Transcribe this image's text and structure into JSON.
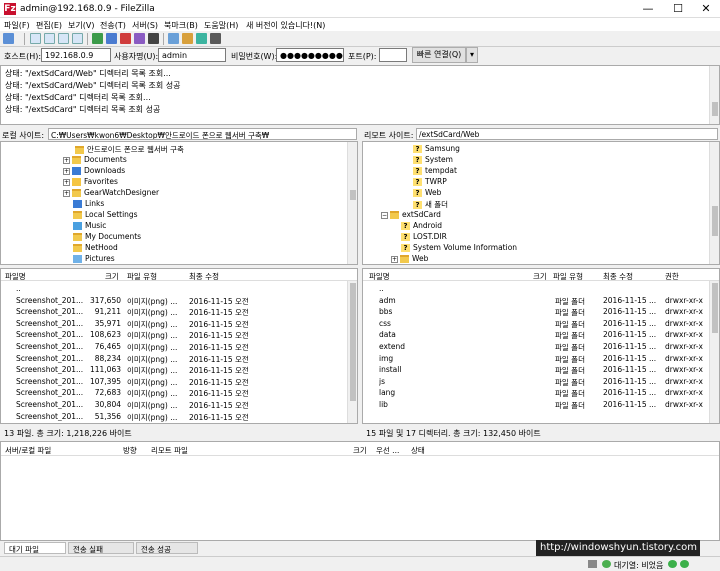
{
  "window": {
    "title": "admin@192.168.0.9 - FileZilla",
    "app_icon": "Fz"
  },
  "menu": [
    "파일(F)",
    "편집(E)",
    "보기(V)",
    "전송(T)",
    "서버(S)",
    "북마크(B)",
    "도움말(H)",
    "새 버전이 있습니다!(N)"
  ],
  "quickconnect": {
    "host_label": "호스트(H):",
    "host_value": "192.168.0.9",
    "user_label": "사용자명(U):",
    "user_value": "admin",
    "pass_label": "비밀번호(W):",
    "pass_value": "●●●●●●●●●",
    "port_label": "포트(P):",
    "port_value": "",
    "connect_label": "빠른 연결(Q)",
    "dropdown": "▾"
  },
  "log": [
    "상태:   \"/extSdCard/Web\" 디렉터리 목록 조회...",
    "상태:   \"/extSdCard/Web\" 디렉터리 목록 조회 성공",
    "상태:   \"/extSdCard\" 디렉터리 목록 조회...",
    "상태:   \"/extSdCard\" 디렉터리 목록 조회 성공"
  ],
  "local": {
    "site_label": "로컬 사이트:",
    "site_path": "C:₩Users₩kwon6₩Desktop₩안드로이드 폰으로 웹서버 구축₩",
    "tree": [
      {
        "label": "안드로이드 폰으로 웹서버 구축",
        "type": "folder"
      },
      {
        "label": "Documents",
        "type": "folder"
      },
      {
        "label": "Downloads",
        "type": "folder"
      },
      {
        "label": "Favorites",
        "type": "folder"
      },
      {
        "label": "GearWatchDesigner",
        "type": "folder"
      },
      {
        "label": "Links",
        "type": "folder"
      },
      {
        "label": "Local Settings",
        "type": "folder"
      },
      {
        "label": "Music",
        "type": "folder"
      },
      {
        "label": "My Documents",
        "type": "folder"
      },
      {
        "label": "NetHood",
        "type": "folder"
      },
      {
        "label": "Pictures",
        "type": "folder"
      }
    ],
    "columns": [
      "파일명",
      "크기",
      "파일 유형",
      "최종 수정"
    ],
    "files": [
      {
        "name": "..",
        "size": "",
        "type": "",
        "modified": ""
      },
      {
        "name": "Screenshot_201...",
        "size": "317,650",
        "type": "이미지(png) ...",
        "modified": "2016-11-15 오전 ..."
      },
      {
        "name": "Screenshot_201...",
        "size": "91,211",
        "type": "이미지(png) ...",
        "modified": "2016-11-15 오전 ..."
      },
      {
        "name": "Screenshot_201...",
        "size": "35,971",
        "type": "이미지(png) ...",
        "modified": "2016-11-15 오전 ..."
      },
      {
        "name": "Screenshot_201...",
        "size": "108,623",
        "type": "이미지(png) ...",
        "modified": "2016-11-15 오전 ..."
      },
      {
        "name": "Screenshot_201...",
        "size": "76,465",
        "type": "이미지(png) ...",
        "modified": "2016-11-15 오전 ..."
      },
      {
        "name": "Screenshot_201...",
        "size": "88,234",
        "type": "이미지(png) ...",
        "modified": "2016-11-15 오전 ..."
      },
      {
        "name": "Screenshot_201...",
        "size": "111,063",
        "type": "이미지(png) ...",
        "modified": "2016-11-15 오전 ..."
      },
      {
        "name": "Screenshot_201...",
        "size": "107,395",
        "type": "이미지(png) ...",
        "modified": "2016-11-15 오전 ..."
      },
      {
        "name": "Screenshot_201...",
        "size": "72,683",
        "type": "이미지(png) ...",
        "modified": "2016-11-15 오전 ..."
      },
      {
        "name": "Screenshot_201...",
        "size": "30,804",
        "type": "이미지(png) ...",
        "modified": "2016-11-15 오전 ..."
      },
      {
        "name": "Screenshot_201...",
        "size": "51,356",
        "type": "이미지(png) ...",
        "modified": "2016-11-15 오전 ..."
      }
    ],
    "status": "13 파일. 총 크기: 1,218,226 바이트"
  },
  "remote": {
    "site_label": "리모트 사이트:",
    "site_path": "/extSdCard/Web",
    "tree": [
      {
        "label": "Samsung",
        "type": "q"
      },
      {
        "label": "System",
        "type": "q"
      },
      {
        "label": "tempdat",
        "type": "q"
      },
      {
        "label": "TWRP",
        "type": "q"
      },
      {
        "label": "Web",
        "type": "q"
      },
      {
        "label": "새 폴더",
        "type": "q"
      },
      {
        "label": "extSdCard",
        "type": "folder"
      },
      {
        "label": "Android",
        "type": "q"
      },
      {
        "label": "LOST.DIR",
        "type": "q"
      },
      {
        "label": "System Volume Information",
        "type": "q"
      },
      {
        "label": "Web",
        "type": "folder"
      }
    ],
    "columns": [
      "파일명",
      "크기",
      "파일 유형",
      "최종 수정",
      "권한"
    ],
    "files": [
      {
        "name": "..",
        "size": "",
        "type": "",
        "modified": "",
        "perm": ""
      },
      {
        "name": "adm",
        "size": "",
        "type": "파일 폴더",
        "modified": "2016-11-15 ...",
        "perm": "drwxr-xr-x"
      },
      {
        "name": "bbs",
        "size": "",
        "type": "파일 폴더",
        "modified": "2016-11-15 ...",
        "perm": "drwxr-xr-x"
      },
      {
        "name": "css",
        "size": "",
        "type": "파일 폴더",
        "modified": "2016-11-15 ...",
        "perm": "drwxr-xr-x"
      },
      {
        "name": "data",
        "size": "",
        "type": "파일 폴더",
        "modified": "2016-11-15 ...",
        "perm": "drwxr-xr-x"
      },
      {
        "name": "extend",
        "size": "",
        "type": "파일 폴더",
        "modified": "2016-11-15 ...",
        "perm": "drwxr-xr-x"
      },
      {
        "name": "img",
        "size": "",
        "type": "파일 폴더",
        "modified": "2016-11-15 ...",
        "perm": "drwxr-xr-x"
      },
      {
        "name": "install",
        "size": "",
        "type": "파일 폴더",
        "modified": "2016-11-15 ...",
        "perm": "drwxr-xr-x"
      },
      {
        "name": "js",
        "size": "",
        "type": "파일 폴더",
        "modified": "2016-11-15 ...",
        "perm": "drwxr-xr-x"
      },
      {
        "name": "lang",
        "size": "",
        "type": "파일 폴더",
        "modified": "2016-11-15 ...",
        "perm": "drwxr-xr-x"
      },
      {
        "name": "lib",
        "size": "",
        "type": "파일 폴더",
        "modified": "2016-11-15 ...",
        "perm": "drwxr-xr-x"
      }
    ],
    "status": "15 파일 및 17 디렉터리. 총 크기: 132,450 바이트"
  },
  "queue": {
    "columns": [
      "서버/로컬 파일",
      "방향",
      "리모트 파일",
      "크기",
      "우선 ...",
      "상태"
    ]
  },
  "tabs": [
    "대기 파일",
    "전송 실패",
    "전송 성공 (2438)"
  ],
  "bottom": {
    "queue_status": "대기열: 비었음"
  },
  "watermark": "http://windowshyun.tistory.com"
}
